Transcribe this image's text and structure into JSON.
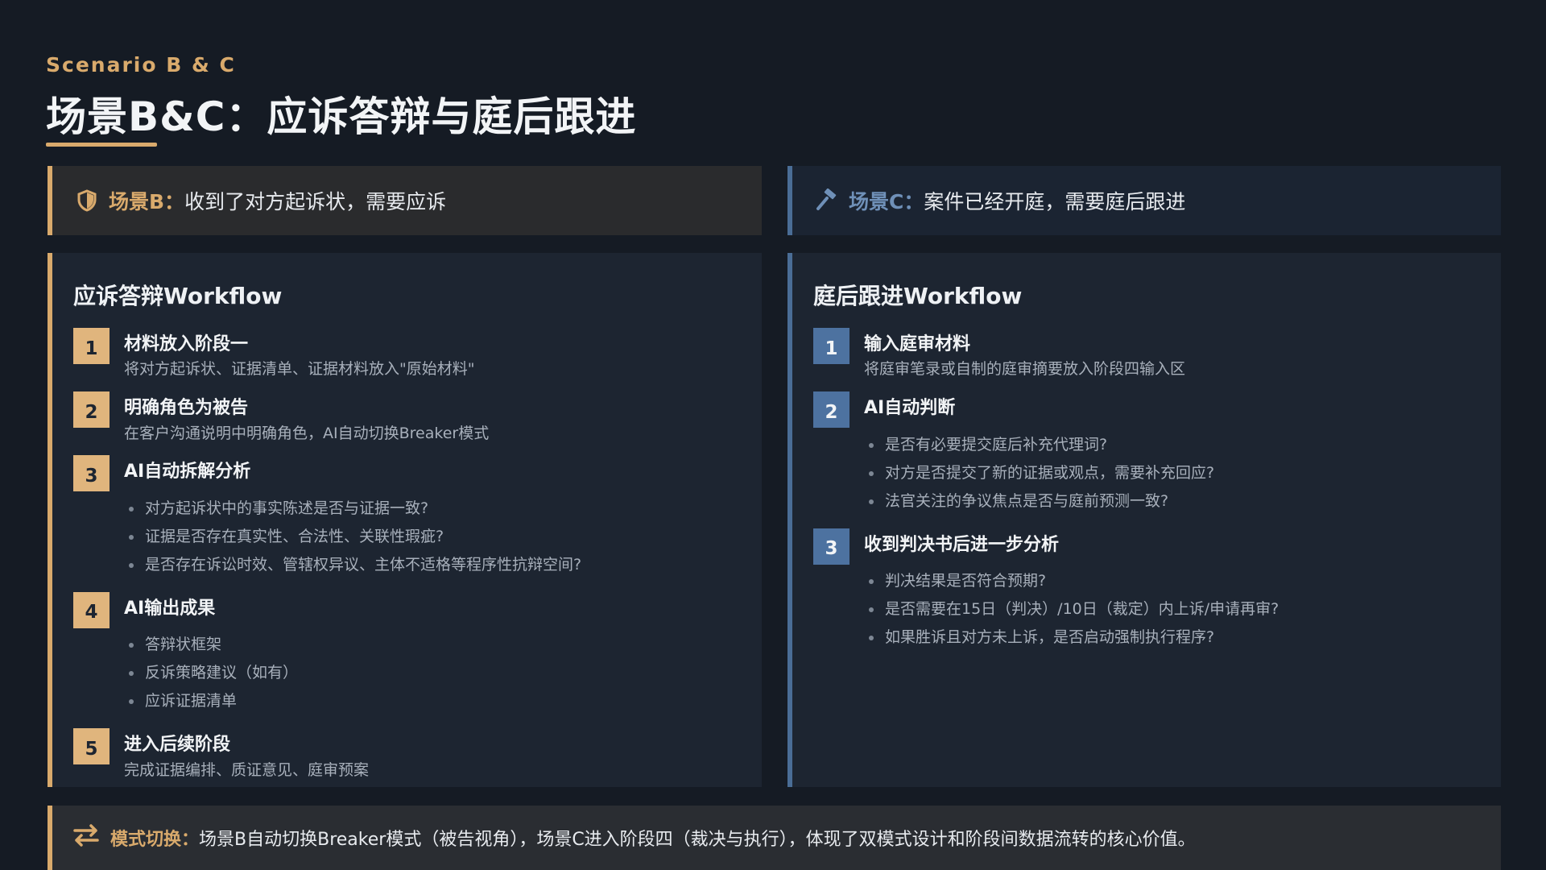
{
  "header": {
    "eyebrow": "Scenario B & C",
    "title": "场景B&C：应诉答辩与庭后跟进"
  },
  "colors": {
    "accent_gold": "#d9aa6c",
    "accent_blue": "#4a6d96"
  },
  "scene_b": {
    "icon": "shield-icon",
    "label": "场景B：",
    "text": "收到了对方起诉状，需要应诉"
  },
  "scene_c": {
    "icon": "gavel-icon",
    "label": "场景C：",
    "text": "案件已经开庭，需要庭后跟进"
  },
  "workflow_b": {
    "title": "应诉答辩Workflow",
    "steps": [
      {
        "num": "1",
        "title": "材料放入阶段一",
        "desc": "将对方起诉状、证据清单、证据材料放入\"原始材料\""
      },
      {
        "num": "2",
        "title": "明确角色为被告",
        "desc": "在客户沟通说明中明确角色，AI自动切换Breaker模式"
      },
      {
        "num": "3",
        "title": "AI自动拆解分析",
        "bullets": [
          "对方起诉状中的事实陈述是否与证据一致?",
          "证据是否存在真实性、合法性、关联性瑕疵?",
          "是否存在诉讼时效、管辖权异议、主体不适格等程序性抗辩空间?"
        ]
      },
      {
        "num": "4",
        "title": "AI输出成果",
        "bullets": [
          "答辩状框架",
          "反诉策略建议（如有）",
          "应诉证据清单"
        ]
      },
      {
        "num": "5",
        "title": "进入后续阶段",
        "desc": "完成证据编排、质证意见、庭审预案"
      }
    ]
  },
  "workflow_c": {
    "title": "庭后跟进Workflow",
    "steps": [
      {
        "num": "1",
        "title": "输入庭审材料",
        "desc": "将庭审笔录或自制的庭审摘要放入阶段四输入区"
      },
      {
        "num": "2",
        "title": "AI自动判断",
        "bullets": [
          "是否有必要提交庭后补充代理词?",
          "对方是否提交了新的证据或观点，需要补充回应?",
          "法官关注的争议焦点是否与庭前预测一致?"
        ]
      },
      {
        "num": "3",
        "title": "收到判决书后进一步分析",
        "bullets": [
          "判决结果是否符合预期?",
          "是否需要在15日（判决）/10日（裁定）内上诉/申请再审?",
          "如果胜诉且对方未上诉，是否启动强制执行程序?"
        ]
      }
    ]
  },
  "footer": {
    "icon": "switch-arrows-icon",
    "label": "模式切换：",
    "text": "场景B自动切换Breaker模式（被告视角），场景C进入阶段四（裁决与执行），体现了双模式设计和阶段间数据流转的核心价值。"
  }
}
